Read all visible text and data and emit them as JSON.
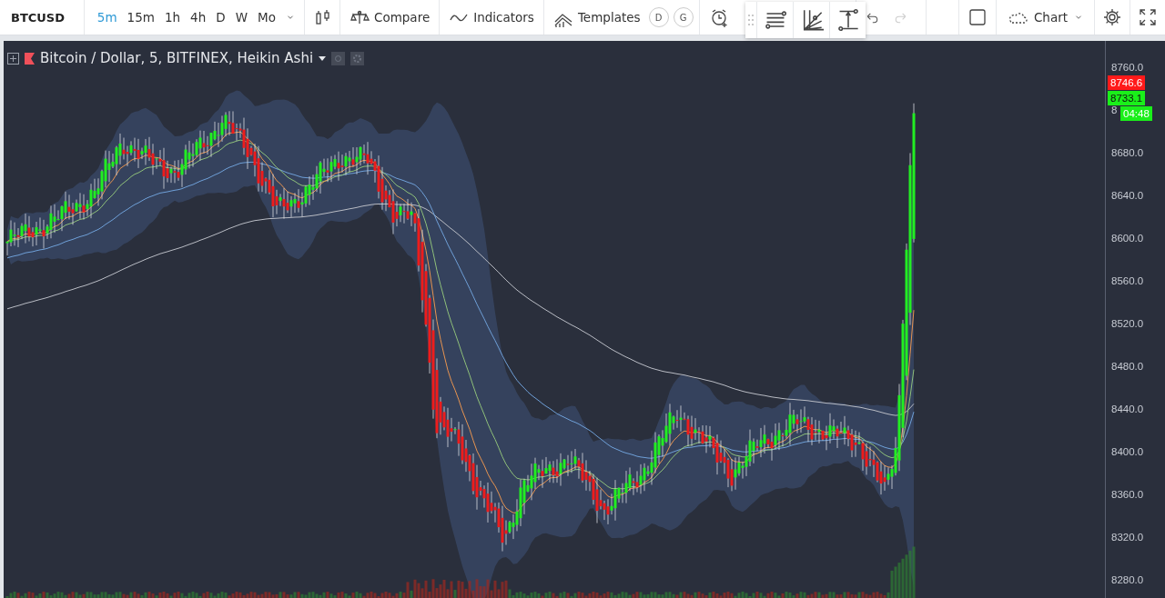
{
  "toolbar": {
    "symbol": "BTCUSD",
    "intervals": [
      {
        "label": "5m",
        "selected": true
      },
      {
        "label": "15m",
        "selected": false
      },
      {
        "label": "1h",
        "selected": false
      },
      {
        "label": "4h",
        "selected": false
      },
      {
        "label": "D",
        "selected": false
      },
      {
        "label": "W",
        "selected": false
      },
      {
        "label": "Mo",
        "selected": false
      }
    ],
    "compare": "Compare",
    "indicators": "Indicators",
    "templates": "Templates",
    "template_badges": [
      "D",
      "G"
    ],
    "undo": {
      "disabled": false
    },
    "redo": {
      "disabled": true
    },
    "layout": "Chart"
  },
  "legend": {
    "title": "Bitcoin / Dollar, 5, BITFINEX, Heikin Ashi"
  },
  "price_axis": {
    "ticks": [
      "8760.0",
      "8",
      "8680.0",
      "8640.0",
      "8600.0",
      "8560.0",
      "8520.0",
      "8480.0",
      "8440.0",
      "8400.0",
      "8360.0",
      "8320.0",
      "8280.0"
    ]
  },
  "price_tags": [
    {
      "text": "8746.6",
      "color": "#ff1a1a"
    },
    {
      "text": "8733.1",
      "color": "#1aef1a"
    },
    {
      "text": "04:48",
      "color": "#1aef1a"
    }
  ]
}
